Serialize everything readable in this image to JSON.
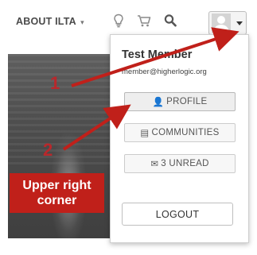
{
  "nav": {
    "about_label": "ABOUT ILTA",
    "about_caret": "▾",
    "icons": [
      "lightbulb-icon",
      "cart-icon",
      "search-icon",
      "user-avatar-icon",
      "caret-down-icon"
    ]
  },
  "dropdown": {
    "name": "Test Member",
    "email": "member@higherlogic.org",
    "profile_icon": "👤",
    "profile_label": "PROFILE",
    "communities_icon": "▤",
    "communities_label": "COMMUNITIES",
    "unread_icon": "✉",
    "unread_label": "3 UNREAD",
    "logout_label": "LOGOUT"
  },
  "annotations": {
    "marker_1": "1",
    "marker_2": "2",
    "callout_line1": "Upper right",
    "callout_line2": "corner",
    "arrow_color": "#c0201a"
  }
}
